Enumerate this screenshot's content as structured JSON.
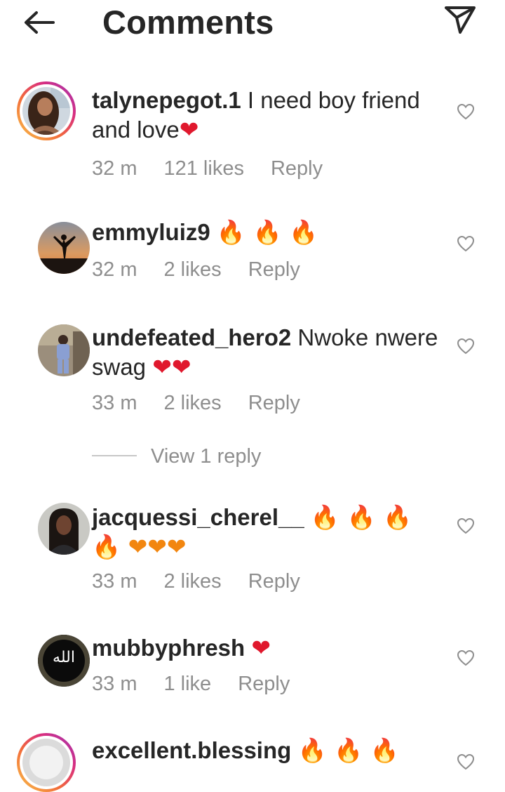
{
  "header": {
    "title": "Comments"
  },
  "comments": [
    {
      "username": "talynepegot.1",
      "text": " I need boy friend and love",
      "emoji": "❤",
      "time": "32 m",
      "likes": "121 likes",
      "reply": "Reply"
    },
    {
      "username": "emmyluiz9",
      "text": " ",
      "emoji": "🔥 🔥 🔥",
      "time": "32 m",
      "likes": "2 likes",
      "reply": "Reply"
    },
    {
      "username": "undefeated_hero2",
      "text": " Nwoke nwere swag ",
      "emoji": "❤❤",
      "time": "33 m",
      "likes": "2 likes",
      "reply": "Reply"
    },
    {
      "username": "jacquessi_cherel__",
      "text": " ",
      "emoji": "🔥 🔥 🔥 🔥 ❤❤❤",
      "time": "33 m",
      "likes": "2 likes",
      "reply": "Reply"
    },
    {
      "username": "mubbyphresh",
      "text": " ",
      "emoji": "❤",
      "time": "33 m",
      "likes": "1 like",
      "reply": "Reply"
    },
    {
      "username": "excellent.blessing",
      "text": " ",
      "emoji": "🔥 🔥 🔥"
    }
  ],
  "view_replies": "View 1 reply",
  "avatar_texts": {
    "mubbyphresh": "الله"
  }
}
